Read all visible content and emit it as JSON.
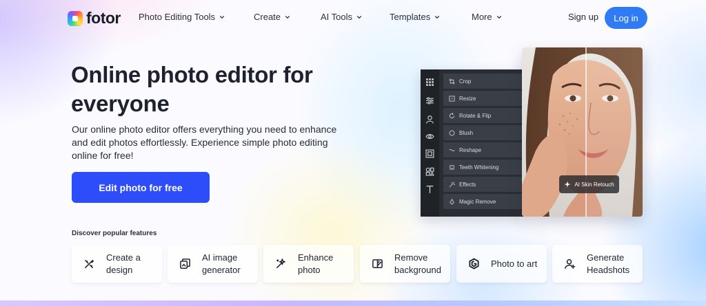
{
  "brand": {
    "name": "fotor"
  },
  "nav": {
    "items": [
      {
        "label": "Photo Editing Tools"
      },
      {
        "label": "Create"
      },
      {
        "label": "AI Tools"
      },
      {
        "label": "Templates"
      },
      {
        "label": "More"
      }
    ],
    "signup_label": "Sign up",
    "login_label": "Log in"
  },
  "hero": {
    "title": "Online photo editor for everyone",
    "description": "Our online photo editor offers everything you need to enhance and edit photos effortlessly. Experience simple photo editing online for free!",
    "cta_label": "Edit photo for free"
  },
  "editor": {
    "tools": [
      {
        "label": "Crop",
        "icon": "crop-icon"
      },
      {
        "label": "Resize",
        "icon": "resize-icon"
      },
      {
        "label": "Rotate & Flip",
        "icon": "rotate-icon"
      },
      {
        "label": "Blush",
        "icon": "blush-icon"
      },
      {
        "label": "Reshape",
        "icon": "reshape-icon"
      },
      {
        "label": "Teeth Whitening",
        "icon": "teeth-icon"
      },
      {
        "label": "Effects",
        "icon": "effects-icon"
      },
      {
        "label": "Magic Remove",
        "icon": "magic-remove-icon"
      }
    ],
    "chip_label": "AI Skin Retouch"
  },
  "features": {
    "title": "Discover popular features",
    "cards": [
      {
        "label": "Create a design",
        "icon": "design-icon"
      },
      {
        "label": "AI image generator",
        "icon": "ai-image-icon"
      },
      {
        "label": "Enhance photo",
        "icon": "enhance-icon"
      },
      {
        "label": "Remove background",
        "icon": "remove-bg-icon"
      },
      {
        "label": "Photo to art",
        "icon": "photo-art-icon"
      },
      {
        "label": "Generate Headshots",
        "icon": "headshot-icon"
      }
    ]
  },
  "colors": {
    "primary": "#2d4dfb",
    "login": "#2f7bf5",
    "text": "#1e2230"
  }
}
